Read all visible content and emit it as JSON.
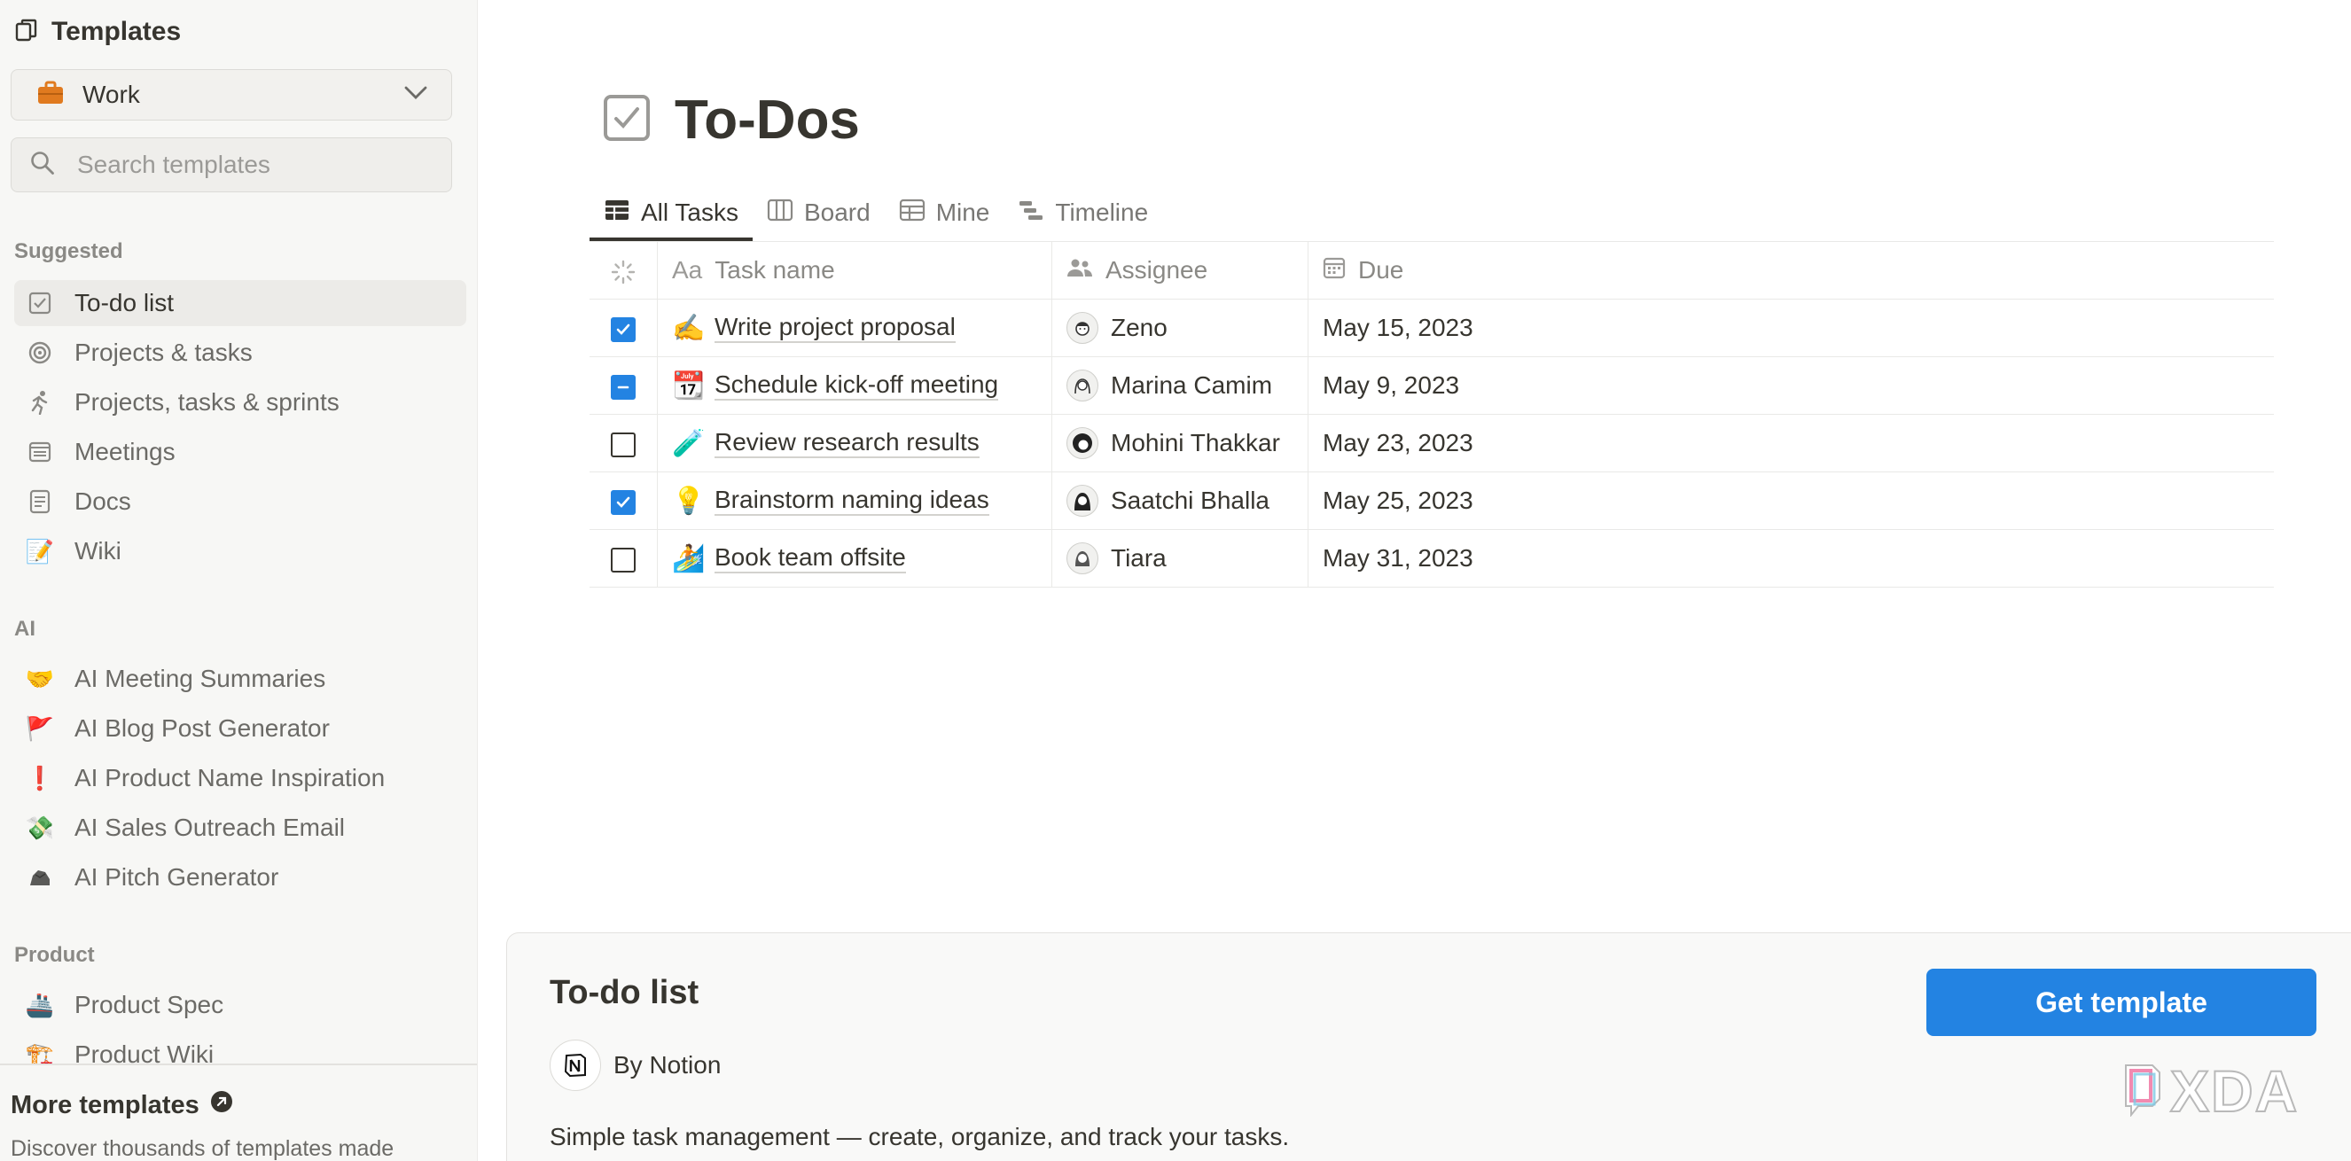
{
  "sidebar": {
    "title": "Templates",
    "category": {
      "label": "Work",
      "icon": "briefcase-icon"
    },
    "search": {
      "placeholder": "Search templates",
      "value": ""
    },
    "sections": {
      "suggested": {
        "title": "Suggested",
        "items": [
          {
            "label": "To-do list",
            "icon": "checkbox-icon",
            "active": true
          },
          {
            "label": "Projects & tasks",
            "icon": "target-icon"
          },
          {
            "label": "Projects, tasks & sprints",
            "icon": "runner-icon"
          },
          {
            "label": "Meetings",
            "icon": "meeting-notes-icon"
          },
          {
            "label": "Docs",
            "icon": "document-icon"
          },
          {
            "label": "Wiki",
            "icon": "memo-icon"
          }
        ]
      },
      "ai": {
        "title": "AI",
        "items": [
          {
            "label": "AI Meeting Summaries",
            "icon": "handshake-icon"
          },
          {
            "label": "AI Blog Post Generator",
            "icon": "red-flag-icon"
          },
          {
            "label": "AI Product Name Inspiration",
            "icon": "exclamation-icon"
          },
          {
            "label": "AI Sales Outreach Email",
            "icon": "money-wings-icon"
          },
          {
            "label": "AI Pitch Generator",
            "icon": "rock-icon"
          }
        ]
      },
      "product": {
        "title": "Product",
        "items": [
          {
            "label": "Product Spec",
            "icon": "ship-icon"
          },
          {
            "label": "Product Wiki",
            "icon": "crane-icon"
          }
        ]
      }
    },
    "footer": {
      "more_label": "More templates",
      "desc": "Discover thousands of templates made"
    }
  },
  "preview": {
    "title": "To-Dos",
    "tabs": [
      {
        "label": "All Tasks",
        "icon": "table-icon",
        "active": true
      },
      {
        "label": "Board",
        "icon": "board-icon"
      },
      {
        "label": "Mine",
        "icon": "table-icon"
      },
      {
        "label": "Timeline",
        "icon": "timeline-icon"
      }
    ],
    "columns": {
      "name_prefix": "Aa",
      "name": "Task name",
      "assignee": "Assignee",
      "due": "Due"
    },
    "rows": [
      {
        "done": "checked",
        "emoji": "✍️",
        "task": "Write project proposal",
        "assignee": "Zeno",
        "due": "May 15, 2023"
      },
      {
        "done": "mixed",
        "emoji": "📆",
        "task": "Schedule kick-off meeting",
        "assignee": "Marina Camim",
        "due": "May 9, 2023"
      },
      {
        "done": "unchecked",
        "emoji": "🧪",
        "task": "Review research results",
        "assignee": "Mohini Thakkar",
        "due": "May 23, 2023"
      },
      {
        "done": "checked",
        "emoji": "💡",
        "task": "Brainstorm naming ideas",
        "assignee": "Saatchi Bhalla",
        "due": "May 25, 2023"
      },
      {
        "done": "unchecked",
        "emoji": "🏄",
        "task": "Book team offsite",
        "assignee": "Tiara",
        "due": "May 31, 2023"
      }
    ]
  },
  "card": {
    "name": "To-do list",
    "author": "By Notion",
    "description": "Simple task management — create, organize, and track your tasks.",
    "cta": "Get template"
  },
  "watermark": "XDA",
  "colors": {
    "accent": "#2383e2",
    "text": "#37352f",
    "muted": "#787774",
    "sidebar_bg": "#f7f7f5"
  }
}
